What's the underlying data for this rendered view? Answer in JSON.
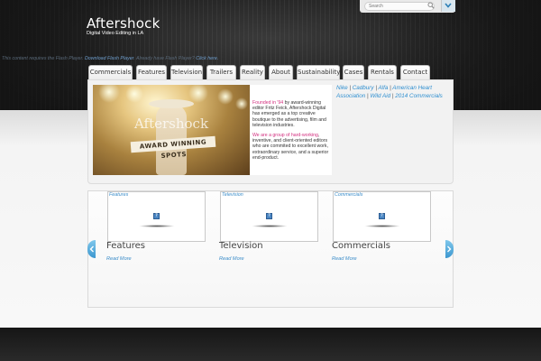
{
  "header": {
    "title": "Aftershock",
    "subtitle": "Digital Video Editing in LA"
  },
  "search": {
    "placeholder": "Search",
    "icon": "search-icon",
    "dropdown_icon": "chevron-down-icon"
  },
  "flash_notice": {
    "prefix": "This content requires the Flash Player. ",
    "download_link": "Download Flash Player",
    "middle": ". Already have Flash Player? ",
    "click_link": "Click here."
  },
  "nav": {
    "tabs": [
      {
        "label": "Commercials"
      },
      {
        "label": "Features"
      },
      {
        "label": "Television"
      },
      {
        "label": "Trailers"
      },
      {
        "label": "Reality"
      },
      {
        "label": "About"
      },
      {
        "label": "Sustainability"
      },
      {
        "label": "Cases"
      },
      {
        "label": "Rentals"
      },
      {
        "label": "Contact"
      }
    ]
  },
  "hero": {
    "image_text": "Aftershock",
    "banner_text": "AWARD WINNING SPOTS",
    "para1_highlight": "Founded in '94",
    "para1_rest": " by award-winning editor Fritz Feick, Aftershock Digital has emerged as a top creative boutique to the advertising, film and television industries.",
    "para2_highlight": "We are a group of hard-working",
    "para2_rest": ", inventive, and client-oriented editors who are commited to excellent work, extraordinary service, and a superior end-product."
  },
  "clients": {
    "links": [
      "Nike",
      "Cadbury",
      "Alfa",
      "American Heart Association",
      "Wild Aid",
      "2014 Commercials"
    ],
    "separator": "|"
  },
  "carousel": {
    "items": [
      {
        "thumb_label": "Features",
        "title": "Features",
        "read_more": "Read More"
      },
      {
        "thumb_label": "Television",
        "title": "Television",
        "read_more": "Read More"
      },
      {
        "thumb_label": "Commercials",
        "title": "Commercials",
        "read_more": "Read More"
      }
    ],
    "missing_plugin_glyph": "?",
    "prev_icon": "chevron-left-icon",
    "next_icon": "chevron-right-icon"
  },
  "colors": {
    "accent_link": "#3a8cc9",
    "highlight_pink": "#d22d7e",
    "header_dark": "#1e1e1e"
  }
}
